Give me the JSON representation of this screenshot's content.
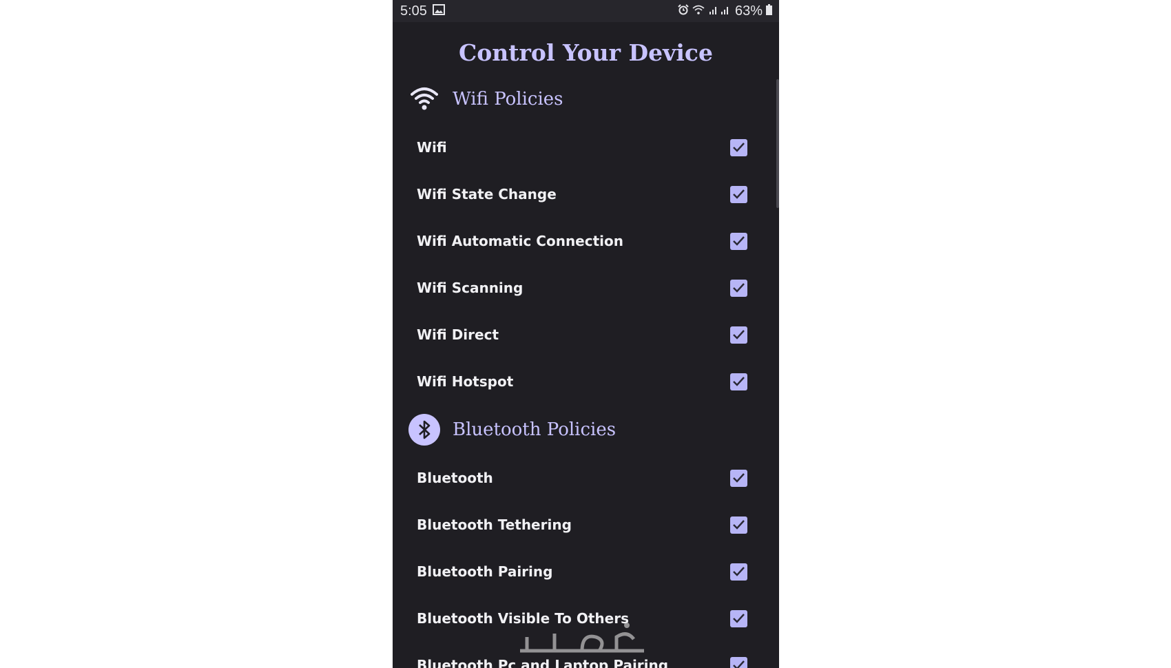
{
  "status_bar": {
    "time": "5:05",
    "battery": "63%"
  },
  "page_title": "Control Your Device",
  "sections": [
    {
      "title": "Wifi Policies",
      "icon": "wifi-icon",
      "items": [
        {
          "label": "Wifi",
          "checked": true
        },
        {
          "label": "Wifi State Change",
          "checked": true
        },
        {
          "label": "Wifi Automatic Connection",
          "checked": true
        },
        {
          "label": "Wifi Scanning",
          "checked": true
        },
        {
          "label": "Wifi Direct",
          "checked": true
        },
        {
          "label": "Wifi Hotspot",
          "checked": true
        }
      ]
    },
    {
      "title": "Bluetooth Policies",
      "icon": "bluetooth-icon",
      "items": [
        {
          "label": "Bluetooth",
          "checked": true
        },
        {
          "label": "Bluetooth Tethering",
          "checked": true
        },
        {
          "label": "Bluetooth Pairing",
          "checked": true
        },
        {
          "label": "Bluetooth Visible To Others",
          "checked": true
        },
        {
          "label": "Bluetooth Pc and Laptop Pairing",
          "checked": true
        }
      ]
    }
  ],
  "colors": {
    "accent": "#c8c3ff",
    "background": "#1f1e23",
    "checkbox": "#b7b5f6"
  },
  "watermark": "خمسات"
}
